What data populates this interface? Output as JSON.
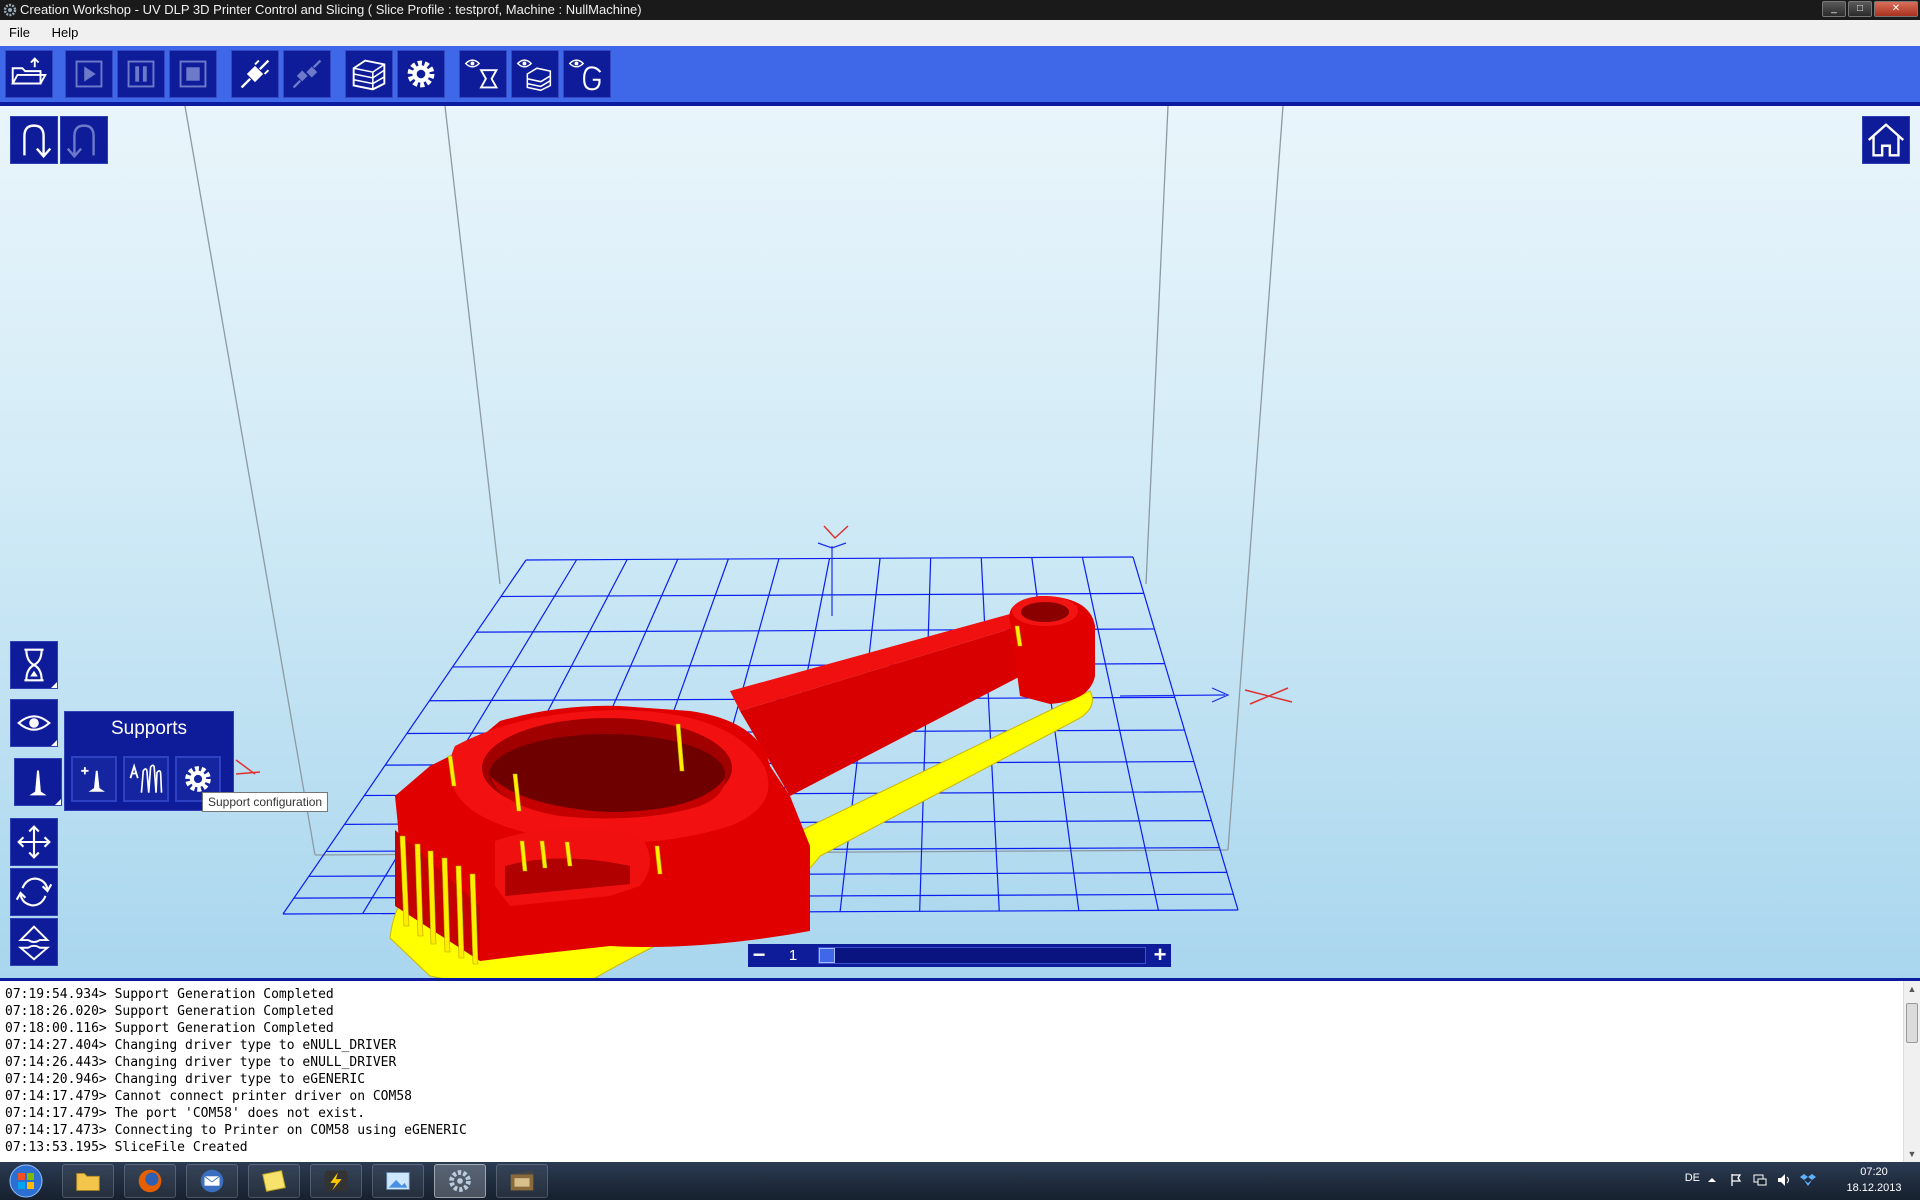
{
  "window": {
    "title": "Creation Workshop - UV DLP 3D Printer Control and Slicing  ( Slice Profile : testprof, Machine : NullMachine)",
    "controls": [
      "minimize",
      "maximize",
      "close"
    ]
  },
  "menu": {
    "items": [
      {
        "label": "File"
      },
      {
        "label": "Help"
      }
    ]
  },
  "toolbar": {
    "buttons": [
      {
        "name": "open-file",
        "icon": "open-folder-icon"
      },
      {
        "name": "play",
        "icon": "play-icon"
      },
      {
        "name": "pause",
        "icon": "pause-icon"
      },
      {
        "name": "stop",
        "icon": "stop-icon"
      },
      {
        "name": "connect",
        "icon": "plug-icon"
      },
      {
        "name": "disconnect",
        "icon": "unplug-icon"
      },
      {
        "name": "slice",
        "icon": "slice-layers-icon"
      },
      {
        "name": "settings",
        "icon": "gear-icon"
      },
      {
        "name": "view-model",
        "icon": "eye-model-icon"
      },
      {
        "name": "view-slice",
        "icon": "eye-slice-icon"
      },
      {
        "name": "view-gcode",
        "icon": "eye-gcode-icon"
      }
    ]
  },
  "viewport": {
    "undo_icon": "undo-icon",
    "redo_icon": "redo-icon",
    "home_icon": "home-icon",
    "left_tools": [
      {
        "name": "hourglass",
        "icon": "hourglass-icon"
      },
      {
        "name": "view",
        "icon": "eye-icon"
      },
      {
        "name": "supports",
        "icon": "support-icon"
      },
      {
        "name": "move",
        "icon": "move-arrows-icon"
      },
      {
        "name": "rotate",
        "icon": "rotate-icon"
      },
      {
        "name": "scale",
        "icon": "scale-icon"
      }
    ],
    "supports_panel": {
      "title": "Supports",
      "buttons": [
        {
          "name": "add-support",
          "icon": "add-support-icon"
        },
        {
          "name": "auto-support",
          "icon": "auto-support-icon"
        },
        {
          "name": "support-config",
          "icon": "gear-icon"
        }
      ],
      "tooltip": "Support configuration"
    },
    "layer_slider": {
      "minus": "−",
      "plus": "+",
      "value": "1",
      "position": 0.0
    },
    "colors": {
      "model": "#e00000",
      "supports": "#ffff00",
      "grid": "#0a1ef0",
      "panel": "#0f1c9a",
      "toolbar": "#3f68e8"
    }
  },
  "log": {
    "lines": [
      "07:19:54.934> Support Generation Completed",
      "07:18:26.020> Support Generation Completed",
      "07:18:00.116> Support Generation Completed",
      "07:14:27.404> Changing driver type to eNULL_DRIVER",
      "07:14:26.443> Changing driver type to eNULL_DRIVER",
      "07:14:20.946> Changing driver type to eGENERIC",
      "07:14:17.479> Cannot connect printer driver on COM58",
      "07:14:17.479> The port 'COM58' does not exist.",
      "07:14:17.473> Connecting to Printer on COM58 using eGENERIC",
      "07:13:53.195> SliceFile Created"
    ]
  },
  "taskbar": {
    "apps": [
      {
        "name": "explorer",
        "icon": "folder-icon"
      },
      {
        "name": "firefox",
        "icon": "firefox-icon"
      },
      {
        "name": "thunderbird",
        "icon": "mail-icon"
      },
      {
        "name": "notes",
        "icon": "note-icon"
      },
      {
        "name": "app-yellow",
        "icon": "lightning-icon"
      },
      {
        "name": "image-viewer",
        "icon": "picture-icon"
      },
      {
        "name": "creation-workshop",
        "icon": "gear-icon"
      },
      {
        "name": "film",
        "icon": "film-icon"
      }
    ],
    "language": "DE",
    "time": "07:20",
    "date": "18.12.2013"
  }
}
